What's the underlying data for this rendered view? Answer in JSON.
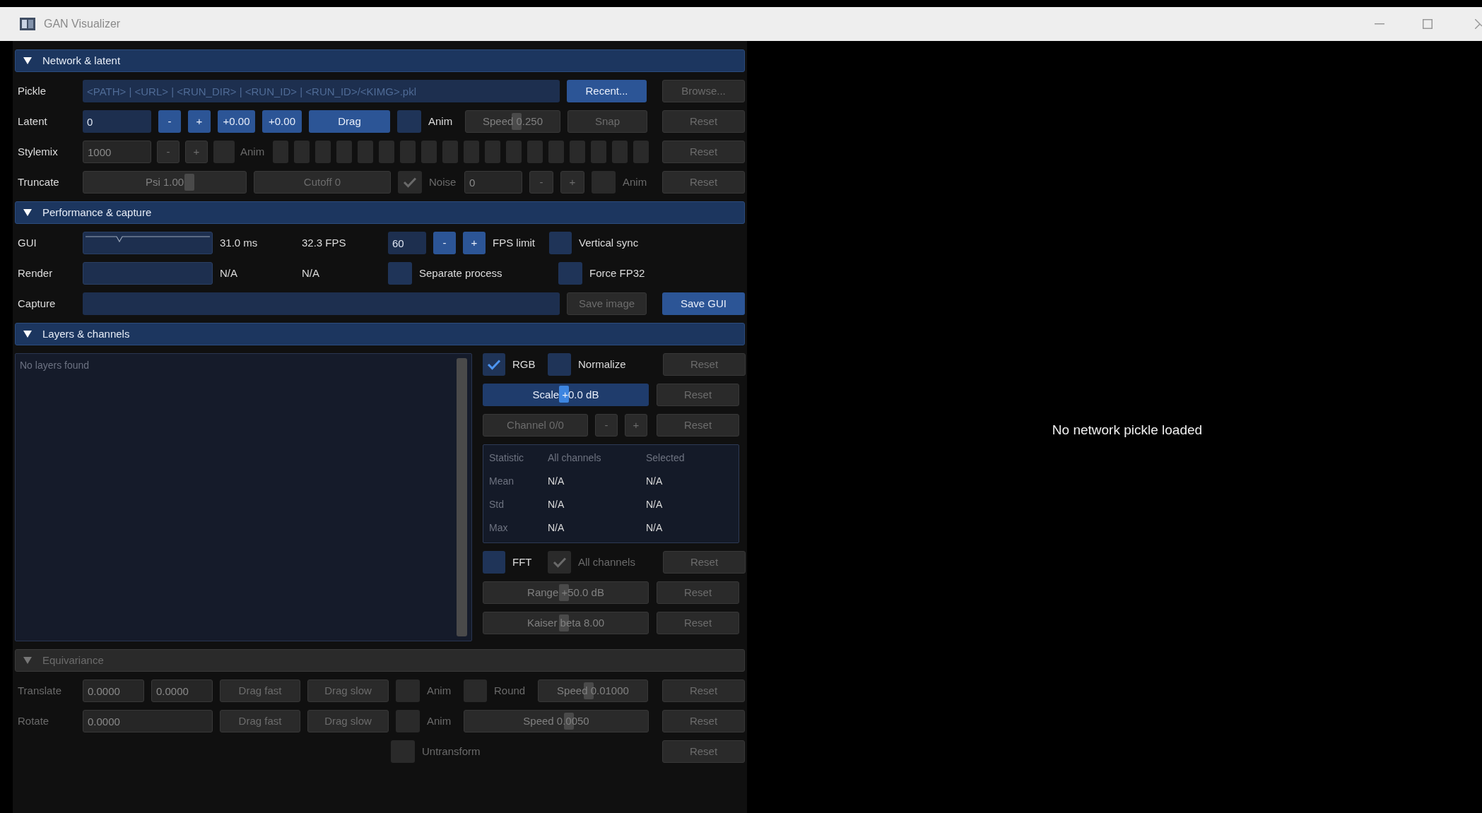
{
  "window": {
    "title": "GAN Visualizer"
  },
  "sections": [
    {
      "title": "Network & latent",
      "kind": "rows",
      "expanded": true,
      "disabled": false,
      "rows": [
        {
          "label": "Pickle",
          "disabled": false,
          "items": [
            {
              "kind": "field",
              "placeholder": "<PATH> | <URL> | <RUN_DIR> | <RUN_ID> | <RUN_ID>/<KIMG>.pkl",
              "disabled": false
            },
            {
              "kind": "button",
              "text": "Recent...",
              "disabled": false
            },
            {
              "kind": "button",
              "text": "Browse...",
              "disabled": true
            }
          ]
        },
        {
          "label": "Latent",
          "disabled": false,
          "items": [
            {
              "kind": "field",
              "value": "0",
              "disabled": false
            },
            {
              "kind": "button",
              "text": "-",
              "disabled": false
            },
            {
              "kind": "button",
              "text": "+",
              "disabled": false
            },
            {
              "kind": "button",
              "text": "+0.00",
              "disabled": false
            },
            {
              "kind": "button",
              "text": "+0.00",
              "disabled": false
            },
            {
              "kind": "button",
              "text": "Drag",
              "disabled": false
            },
            {
              "kind": "checkbox",
              "checked": false,
              "disabled": false
            },
            {
              "kind": "text",
              "text": "Anim",
              "disabled": false
            },
            {
              "kind": "slider",
              "text": "Speed 0.250",
              "level": 0.54,
              "disabled": true
            },
            {
              "kind": "button",
              "text": "Snap",
              "disabled": true
            },
            {
              "kind": "button",
              "text": "Reset",
              "disabled": true
            }
          ]
        },
        {
          "label": "Stylemix",
          "disabled": false,
          "items": [
            {
              "kind": "field",
              "value": "1000",
              "disabled": true
            },
            {
              "kind": "button",
              "text": "-",
              "disabled": true
            },
            {
              "kind": "button",
              "text": "+",
              "disabled": true
            },
            {
              "kind": "checkbox",
              "checked": false,
              "disabled": true
            },
            {
              "kind": "text",
              "text": "Anim",
              "disabled": true
            },
            {
              "kind": "checkbox",
              "checked": false,
              "disabled": true
            },
            {
              "kind": "checkbox",
              "checked": false,
              "disabled": true
            },
            {
              "kind": "checkbox",
              "checked": false,
              "disabled": true
            },
            {
              "kind": "checkbox",
              "checked": false,
              "disabled": true
            },
            {
              "kind": "checkbox",
              "checked": false,
              "disabled": true
            },
            {
              "kind": "checkbox",
              "checked": false,
              "disabled": true
            },
            {
              "kind": "checkbox",
              "checked": false,
              "disabled": true
            },
            {
              "kind": "checkbox",
              "checked": false,
              "disabled": true
            },
            {
              "kind": "checkbox",
              "checked": false,
              "disabled": true
            },
            {
              "kind": "checkbox",
              "checked": false,
              "disabled": true
            },
            {
              "kind": "checkbox",
              "checked": false,
              "disabled": true
            },
            {
              "kind": "checkbox",
              "checked": false,
              "disabled": true
            },
            {
              "kind": "checkbox",
              "checked": false,
              "disabled": true
            },
            {
              "kind": "checkbox",
              "checked": false,
              "disabled": true
            },
            {
              "kind": "checkbox",
              "checked": false,
              "disabled": true
            },
            {
              "kind": "checkbox",
              "checked": false,
              "disabled": true
            },
            {
              "kind": "checkbox",
              "checked": false,
              "disabled": true
            },
            {
              "kind": "checkbox",
              "checked": false,
              "disabled": true
            },
            {
              "kind": "button",
              "text": "Reset",
              "disabled": true
            }
          ]
        },
        {
          "label": "Truncate",
          "disabled": false,
          "items": [
            {
              "kind": "slider",
              "text": "Psi 1.00",
              "level": 0.65,
              "disabled": true
            },
            {
              "kind": "button",
              "text": "Cutoff 0",
              "disabled": true
            },
            {
              "kind": "checkbox",
              "checked": true,
              "disabled": true
            },
            {
              "kind": "text",
              "text": "Noise",
              "disabled": true
            },
            {
              "kind": "field",
              "value": "0",
              "disabled": true
            },
            {
              "kind": "button",
              "text": "-",
              "disabled": true
            },
            {
              "kind": "button",
              "text": "+",
              "disabled": true
            },
            {
              "kind": "checkbox",
              "checked": false,
              "disabled": true
            },
            {
              "kind": "text",
              "text": "Anim",
              "disabled": true
            },
            {
              "kind": "button",
              "text": "Reset",
              "disabled": true
            }
          ]
        }
      ]
    },
    {
      "title": "Performance & capture",
      "kind": "rows",
      "expanded": true,
      "disabled": false,
      "rows": [
        {
          "label": "GUI",
          "disabled": false,
          "items": [
            {
              "kind": "plot",
              "trace": true,
              "disabled": false
            },
            {
              "kind": "text",
              "text": "31.0 ms",
              "disabled": false
            },
            {
              "kind": "text",
              "text": "32.3 FPS",
              "disabled": false
            },
            {
              "kind": "field",
              "value": "60",
              "disabled": false
            },
            {
              "kind": "button",
              "text": "-",
              "disabled": false
            },
            {
              "kind": "button",
              "text": "+",
              "disabled": false
            },
            {
              "kind": "text",
              "text": "FPS limit",
              "disabled": false
            },
            {
              "kind": "checkbox",
              "checked": false,
              "disabled": false
            },
            {
              "kind": "text",
              "text": "Vertical sync",
              "disabled": false
            }
          ]
        },
        {
          "label": "Render",
          "disabled": false,
          "items": [
            {
              "kind": "plot",
              "trace": false,
              "disabled": false
            },
            {
              "kind": "text",
              "text": "N/A",
              "disabled": false
            },
            {
              "kind": "text",
              "text": "N/A",
              "disabled": false
            },
            {
              "kind": "checkbox",
              "checked": false,
              "disabled": false
            },
            {
              "kind": "text",
              "text": "Separate process",
              "disabled": false
            },
            {
              "kind": "checkbox",
              "checked": false,
              "disabled": false
            },
            {
              "kind": "text",
              "text": "Force FP32",
              "disabled": false
            }
          ]
        },
        {
          "label": "Capture",
          "disabled": false,
          "items": [
            {
              "kind": "field",
              "disabled": false
            },
            {
              "kind": "button",
              "text": "Save image",
              "disabled": true
            },
            {
              "kind": "button",
              "text": "Save GUI",
              "disabled": false
            }
          ]
        }
      ]
    },
    {
      "title": "Layers & channels",
      "kind": "layers",
      "expanded": true,
      "disabled": false,
      "list": {
        "empty_text": "No layers found"
      },
      "controls": [
        {
          "kind": "row",
          "items": [
            {
              "kind": "checkbox",
              "checked": true,
              "disabled": false
            },
            {
              "kind": "text",
              "text": "RGB",
              "disabled": false
            },
            {
              "kind": "checkbox",
              "checked": false,
              "disabled": false
            },
            {
              "kind": "text",
              "text": "Normalize",
              "disabled": false
            },
            {
              "kind": "button",
              "text": "Reset",
              "disabled": true
            }
          ]
        },
        {
          "kind": "row",
          "items": [
            {
              "kind": "slider",
              "text": "Scale +0.0 dB",
              "level": 0.49,
              "disabled": false
            },
            {
              "kind": "button",
              "text": "Reset",
              "disabled": true
            }
          ]
        },
        {
          "kind": "row",
          "items": [
            {
              "kind": "button",
              "text": "Channel 0/0",
              "disabled": true
            },
            {
              "kind": "button",
              "text": "-",
              "disabled": true
            },
            {
              "kind": "button",
              "text": "+",
              "disabled": true
            },
            {
              "kind": "button",
              "text": "Reset",
              "disabled": true
            }
          ]
        },
        {
          "kind": "table",
          "columns": [
            "Statistic",
            "All channels",
            "Selected"
          ],
          "rows": [
            [
              "Mean",
              "N/A",
              "N/A"
            ],
            [
              "Std",
              "N/A",
              "N/A"
            ],
            [
              "Max",
              "N/A",
              "N/A"
            ]
          ]
        },
        {
          "kind": "row",
          "items": [
            {
              "kind": "checkbox",
              "checked": false,
              "disabled": false
            },
            {
              "kind": "text",
              "text": "FFT",
              "disabled": false
            },
            {
              "kind": "checkbox",
              "checked": true,
              "disabled": true
            },
            {
              "kind": "text",
              "text": "All channels",
              "disabled": true
            },
            {
              "kind": "button",
              "text": "Reset",
              "disabled": true
            }
          ]
        },
        {
          "kind": "row",
          "items": [
            {
              "kind": "slider",
              "text": "Range +50.0 dB",
              "level": 0.49,
              "disabled": true
            },
            {
              "kind": "button",
              "text": "Reset",
              "disabled": true
            }
          ]
        },
        {
          "kind": "row",
          "items": [
            {
              "kind": "slider",
              "text": "Kaiser beta 8.00",
              "level": 0.49,
              "disabled": true
            },
            {
              "kind": "button",
              "text": "Reset",
              "disabled": true
            }
          ]
        }
      ]
    },
    {
      "title": "Equivariance",
      "kind": "rows",
      "expanded": true,
      "disabled": true,
      "rows": [
        {
          "label": "Translate",
          "disabled": true,
          "items": [
            {
              "kind": "field",
              "value": "0.0000",
              "disabled": true
            },
            {
              "kind": "field",
              "value": "0.0000",
              "disabled": true
            },
            {
              "kind": "button",
              "text": "Drag fast",
              "disabled": true
            },
            {
              "kind": "button",
              "text": "Drag slow",
              "disabled": true
            },
            {
              "kind": "checkbox",
              "checked": false,
              "disabled": true
            },
            {
              "kind": "text",
              "text": "Anim",
              "disabled": true
            },
            {
              "kind": "checkbox",
              "checked": false,
              "disabled": true
            },
            {
              "kind": "text",
              "text": "Round",
              "disabled": true
            },
            {
              "kind": "slider",
              "text": "Speed 0.01000",
              "level": 0.46,
              "disabled": true
            },
            {
              "kind": "button",
              "text": "Reset",
              "disabled": true
            }
          ]
        },
        {
          "label": "Rotate",
          "disabled": true,
          "items": [
            {
              "kind": "field",
              "value": "0.0000",
              "disabled": true
            },
            {
              "kind": "button",
              "text": "Drag fast",
              "disabled": true
            },
            {
              "kind": "button",
              "text": "Drag slow",
              "disabled": true
            },
            {
              "kind": "checkbox",
              "checked": false,
              "disabled": true
            },
            {
              "kind": "text",
              "text": "Anim",
              "disabled": true
            },
            {
              "kind": "slider",
              "text": "Speed 0.0050",
              "level": 0.57,
              "disabled": true
            },
            {
              "kind": "button",
              "text": "Reset",
              "disabled": true
            }
          ]
        },
        {
          "items": [
            {
              "kind": "checkbox",
              "checked": false,
              "disabled": true
            },
            {
              "kind": "text",
              "text": "Untransform",
              "disabled": true
            },
            {
              "kind": "button",
              "text": "Reset",
              "disabled": true
            }
          ]
        }
      ]
    }
  ],
  "viewport": {
    "message": "No network pickle loaded"
  }
}
